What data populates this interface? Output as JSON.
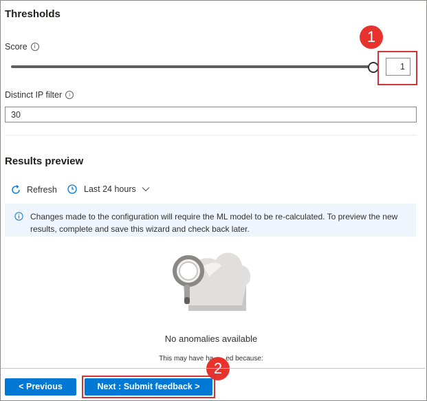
{
  "thresholds": {
    "heading": "Thresholds",
    "score": {
      "label": "Score",
      "info_icon": "info-icon",
      "value": "1",
      "slider_level": 1.0
    },
    "distinct_ip": {
      "label": "Distinct IP filter",
      "info_icon": "info-icon",
      "value": "30"
    }
  },
  "results": {
    "heading": "Results preview",
    "refresh_label": "Refresh",
    "time_range_label": "Last 24 hours",
    "info_message": "Changes made to the configuration will require the ML model to be re-calculated. To preview the new results, complete and save this wizard and check back later.",
    "empty_title": "No anomalies available",
    "empty_subtitle_before": "This may have ha",
    "empty_subtitle_after": "ed because:"
  },
  "footer": {
    "previous_label": "< Previous",
    "next_label": "Next : Submit feedback >"
  },
  "callouts": {
    "first": "1",
    "second": "2"
  },
  "colors": {
    "accent": "#0078d4",
    "callout": "#d13438",
    "badge": "#e8322d",
    "info_bg": "#eef5fc"
  }
}
